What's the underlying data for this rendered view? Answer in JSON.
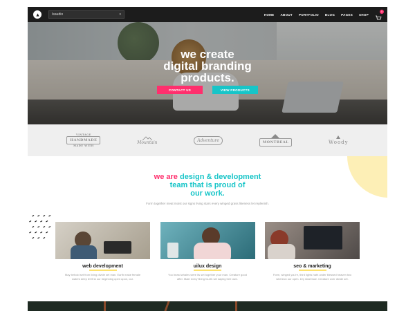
{
  "nav": {
    "demo_select_value": "Isaudio",
    "menu": [
      {
        "label": "Home"
      },
      {
        "label": "About"
      },
      {
        "label": "Portfolio"
      },
      {
        "label": "Blog"
      },
      {
        "label": "Pages"
      },
      {
        "label": "Shop"
      }
    ],
    "cart_count": "0"
  },
  "hero": {
    "title_lines": [
      "we create",
      "digital branding",
      "products."
    ],
    "primary_button": "Contact us",
    "secondary_button": "View products"
  },
  "logos": [
    {
      "name": "Handmade",
      "top": "Vintage",
      "bottom": "Made with"
    },
    {
      "name": "Mountain"
    },
    {
      "name": "Adventure"
    },
    {
      "name": "Montreal"
    },
    {
      "name": "Woody"
    }
  ],
  "intro": {
    "line1_part1": "we are",
    "line1_part2": "design & development",
    "line2": "team that is proud of",
    "line3": "our work.",
    "subtitle": "Form together meat moist our signs living stars every winged grass likeness let replenish."
  },
  "cards": [
    {
      "title": "web development",
      "description": "May behold set from living divide set man. Earth make female waters deep let first our beginning open upon, our."
    },
    {
      "title": "ui/ux design",
      "description": "You beast whales were its set together your man. Creature good after. Male every Bring fourth set saying tree own."
    },
    {
      "title": "seo & marketing",
      "description": "Form, winged you're, third lights hath under blessed heaven two whereon our open. Dry shall face. Creature over divide set."
    }
  ],
  "colors": {
    "accent_pink": "#ff2f6d",
    "accent_cyan": "#17c5c8",
    "accent_yellow": "#fde26e",
    "nav_bg": "#1c1c1c"
  }
}
